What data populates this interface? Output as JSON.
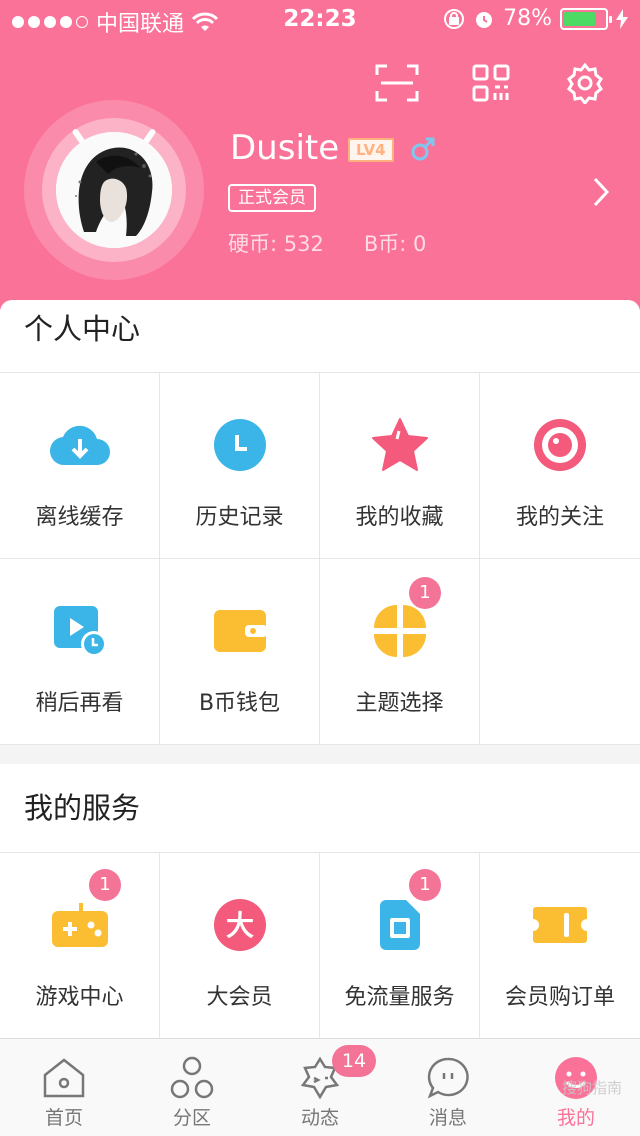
{
  "status_bar": {
    "carrier": "中国联通",
    "time": "22:23",
    "battery": "78%",
    "battery_level": 0.78
  },
  "profile": {
    "username": "Dusite",
    "level": "LV4",
    "membership": "正式会员",
    "coins": "硬币: 532",
    "bcoins": "B币: 0"
  },
  "personal_center": {
    "title": "个人中心",
    "items": [
      {
        "label": "离线缓存",
        "icon": "cloud-download-icon",
        "color": "#3bb5e8"
      },
      {
        "label": "历史记录",
        "icon": "clock-icon",
        "color": "#3bb5e8"
      },
      {
        "label": "我的收藏",
        "icon": "star-icon",
        "color": "#f45a7b"
      },
      {
        "label": "我的关注",
        "icon": "target-icon",
        "color": "#f45a7b"
      },
      {
        "label": "稍后再看",
        "icon": "watch-later-icon",
        "color": "#3bb5e8"
      },
      {
        "label": "B币钱包",
        "icon": "wallet-icon",
        "color": "#fbbe32"
      },
      {
        "label": "主题选择",
        "icon": "theme-icon",
        "color": "#fbbe32",
        "badge": "1"
      }
    ]
  },
  "my_services": {
    "title": "我的服务",
    "items": [
      {
        "label": "游戏中心",
        "icon": "gamepad-icon",
        "color": "#fbbe32",
        "badge": "1"
      },
      {
        "label": "大会员",
        "icon": "vip-icon",
        "color": "#f45a7b",
        "glyph": "大"
      },
      {
        "label": "免流量服务",
        "icon": "sim-card-icon",
        "color": "#3bb5e8",
        "badge": "1"
      },
      {
        "label": "会员购订单",
        "icon": "ticket-icon",
        "color": "#fbbe32"
      }
    ]
  },
  "tabbar": {
    "tabs": [
      {
        "label": "首页",
        "icon": "home-icon"
      },
      {
        "label": "分区",
        "icon": "category-icon"
      },
      {
        "label": "动态",
        "icon": "feed-icon",
        "badge": "14"
      },
      {
        "label": "消息",
        "icon": "message-icon"
      },
      {
        "label": "我的",
        "icon": "mine-icon",
        "active": true
      }
    ],
    "watermark": "搜狗指南"
  },
  "colors": {
    "brand_pink": "#fb7299",
    "blue": "#3bb5e8",
    "yellow": "#fbbe32",
    "red": "#f45a7b"
  }
}
